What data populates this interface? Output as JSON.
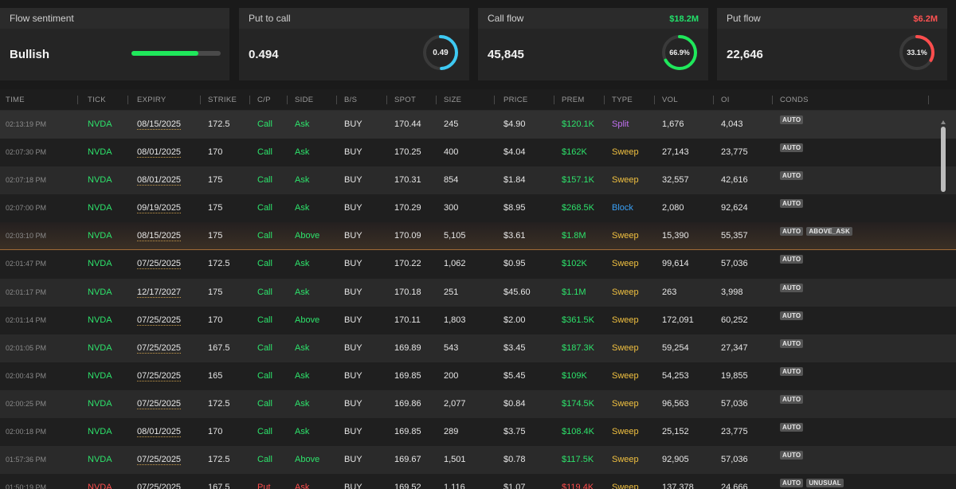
{
  "cards": {
    "sentiment": {
      "title": "Flow sentiment",
      "value": "Bullish",
      "bar_fraction": 0.75,
      "bar_color": "#1fe85b"
    },
    "put_to_call": {
      "title": "Put to call",
      "value": "0.494",
      "gauge_label": "0.49",
      "gauge_fraction": 0.49,
      "gauge_color": "#3ec9f2"
    },
    "call_flow": {
      "title": "Call flow",
      "amount": "$18.2M",
      "value": "45,845",
      "gauge_label": "66.9%",
      "gauge_fraction": 0.669,
      "gauge_color": "#1fe85b"
    },
    "put_flow": {
      "title": "Put flow",
      "amount": "$6.2M",
      "value": "22,646",
      "gauge_label": "33.1%",
      "gauge_fraction": 0.331,
      "gauge_color": "#ff4d4d"
    }
  },
  "table": {
    "headers": {
      "time": "TIME",
      "tick": "TICK",
      "expiry": "EXPIRY",
      "strike": "STRIKE",
      "cp": "C/P",
      "side": "SIDE",
      "bs": "B/S",
      "spot": "SPOT",
      "size": "SIZE",
      "price": "PRICE",
      "prem": "PREM",
      "type": "TYPE",
      "vol": "VOL",
      "oi": "OI",
      "conds": "CONDS"
    },
    "rows": [
      {
        "time": "02:13:19 PM",
        "tick": "NVDA",
        "expiry": "08/15/2025",
        "strike": "172.5",
        "cp": "Call",
        "side": "Ask",
        "bs": "BUY",
        "spot": "170.44",
        "size": "245",
        "price": "$4.90",
        "prem": "$120.1K",
        "type": "Split",
        "vol": "1,676",
        "oi": "4,043",
        "conds": [
          "AUTO"
        ]
      },
      {
        "time": "02:07:30 PM",
        "tick": "NVDA",
        "expiry": "08/01/2025",
        "strike": "170",
        "cp": "Call",
        "side": "Ask",
        "bs": "BUY",
        "spot": "170.25",
        "size": "400",
        "price": "$4.04",
        "prem": "$162K",
        "type": "Sweep",
        "vol": "27,143",
        "oi": "23,775",
        "conds": [
          "AUTO"
        ]
      },
      {
        "time": "02:07:18 PM",
        "tick": "NVDA",
        "expiry": "08/01/2025",
        "strike": "175",
        "cp": "Call",
        "side": "Ask",
        "bs": "BUY",
        "spot": "170.31",
        "size": "854",
        "price": "$1.84",
        "prem": "$157.1K",
        "type": "Sweep",
        "vol": "32,557",
        "oi": "42,616",
        "conds": [
          "AUTO"
        ]
      },
      {
        "time": "02:07:00 PM",
        "tick": "NVDA",
        "expiry": "09/19/2025",
        "strike": "175",
        "cp": "Call",
        "side": "Ask",
        "bs": "BUY",
        "spot": "170.29",
        "size": "300",
        "price": "$8.95",
        "prem": "$268.5K",
        "type": "Block",
        "vol": "2,080",
        "oi": "92,624",
        "conds": [
          "AUTO"
        ]
      },
      {
        "time": "02:03:10 PM",
        "tick": "NVDA",
        "expiry": "08/15/2025",
        "strike": "175",
        "cp": "Call",
        "side": "Above",
        "bs": "BUY",
        "spot": "170.09",
        "size": "5,105",
        "price": "$3.61",
        "prem": "$1.8M",
        "type": "Sweep",
        "vol": "15,390",
        "oi": "55,357",
        "conds": [
          "AUTO",
          "ABOVE_ASK"
        ]
      },
      {
        "time": "02:01:47 PM",
        "tick": "NVDA",
        "expiry": "07/25/2025",
        "strike": "172.5",
        "cp": "Call",
        "side": "Ask",
        "bs": "BUY",
        "spot": "170.22",
        "size": "1,062",
        "price": "$0.95",
        "prem": "$102K",
        "type": "Sweep",
        "vol": "99,614",
        "oi": "57,036",
        "conds": [
          "AUTO"
        ]
      },
      {
        "time": "02:01:17 PM",
        "tick": "NVDA",
        "expiry": "12/17/2027",
        "strike": "175",
        "cp": "Call",
        "side": "Ask",
        "bs": "BUY",
        "spot": "170.18",
        "size": "251",
        "price": "$45.60",
        "prem": "$1.1M",
        "type": "Sweep",
        "vol": "263",
        "oi": "3,998",
        "conds": [
          "AUTO"
        ]
      },
      {
        "time": "02:01:14 PM",
        "tick": "NVDA",
        "expiry": "07/25/2025",
        "strike": "170",
        "cp": "Call",
        "side": "Above",
        "bs": "BUY",
        "spot": "170.11",
        "size": "1,803",
        "price": "$2.00",
        "prem": "$361.5K",
        "type": "Sweep",
        "vol": "172,091",
        "oi": "60,252",
        "conds": [
          "AUTO"
        ]
      },
      {
        "time": "02:01:05 PM",
        "tick": "NVDA",
        "expiry": "07/25/2025",
        "strike": "167.5",
        "cp": "Call",
        "side": "Ask",
        "bs": "BUY",
        "spot": "169.89",
        "size": "543",
        "price": "$3.45",
        "prem": "$187.3K",
        "type": "Sweep",
        "vol": "59,254",
        "oi": "27,347",
        "conds": [
          "AUTO"
        ]
      },
      {
        "time": "02:00:43 PM",
        "tick": "NVDA",
        "expiry": "07/25/2025",
        "strike": "165",
        "cp": "Call",
        "side": "Ask",
        "bs": "BUY",
        "spot": "169.85",
        "size": "200",
        "price": "$5.45",
        "prem": "$109K",
        "type": "Sweep",
        "vol": "54,253",
        "oi": "19,855",
        "conds": [
          "AUTO"
        ]
      },
      {
        "time": "02:00:25 PM",
        "tick": "NVDA",
        "expiry": "07/25/2025",
        "strike": "172.5",
        "cp": "Call",
        "side": "Ask",
        "bs": "BUY",
        "spot": "169.86",
        "size": "2,077",
        "price": "$0.84",
        "prem": "$174.5K",
        "type": "Sweep",
        "vol": "96,563",
        "oi": "57,036",
        "conds": [
          "AUTO"
        ]
      },
      {
        "time": "02:00:18 PM",
        "tick": "NVDA",
        "expiry": "08/01/2025",
        "strike": "170",
        "cp": "Call",
        "side": "Ask",
        "bs": "BUY",
        "spot": "169.85",
        "size": "289",
        "price": "$3.75",
        "prem": "$108.4K",
        "type": "Sweep",
        "vol": "25,152",
        "oi": "23,775",
        "conds": [
          "AUTO"
        ]
      },
      {
        "time": "01:57:36 PM",
        "tick": "NVDA",
        "expiry": "07/25/2025",
        "strike": "172.5",
        "cp": "Call",
        "side": "Above",
        "bs": "BUY",
        "spot": "169.67",
        "size": "1,501",
        "price": "$0.78",
        "prem": "$117.5K",
        "type": "Sweep",
        "vol": "92,905",
        "oi": "57,036",
        "conds": [
          "AUTO"
        ]
      },
      {
        "time": "01:50:19 PM",
        "tick": "NVDA",
        "expiry": "07/25/2025",
        "strike": "167.5",
        "cp": "Put",
        "side": "Ask",
        "bs": "BUY",
        "spot": "169.52",
        "size": "1,116",
        "price": "$1.07",
        "prem": "$119.4K",
        "type": "Sweep",
        "vol": "137,378",
        "oi": "24,666",
        "conds": [
          "AUTO",
          "UNUSUAL"
        ]
      }
    ]
  },
  "colors": {
    "call": "#2de36b",
    "put": "#ff4d4d",
    "type_split": "#c070f0",
    "type_sweep": "#f0c040",
    "type_block": "#3aa0f5"
  }
}
